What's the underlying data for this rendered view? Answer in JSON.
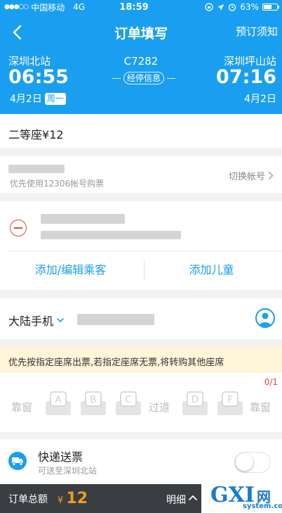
{
  "status_bar": {
    "carrier": "中国移动",
    "network": "4G",
    "time": "18:59",
    "battery": "63%",
    "battery_level": 0.63
  },
  "header": {
    "title": "订单填写",
    "right_action": "预订须知"
  },
  "train": {
    "from_station": "深圳北站",
    "to_station": "深圳坪山站",
    "train_no": "C7282",
    "depart_time": "06:55",
    "arrive_time": "07:16",
    "depart_date": "4月2日",
    "depart_weekday": "周一",
    "arrive_date": "4月2日",
    "stop_info": "经停信息"
  },
  "seat": {
    "label": "二等座",
    "price": "¥12"
  },
  "account": {
    "hint": "优先使用12306帐号购票",
    "switch_label": "切换帐号"
  },
  "passenger": {
    "add_edit_label": "添加/编辑乘客",
    "add_child_label": "添加儿童"
  },
  "contact": {
    "phone_region": "大陆手机"
  },
  "seat_tip": "优先按指定座席出票,若指定座席无票,将转购其他座席",
  "seat_select": {
    "count": "0/1",
    "window_left": "靠窗",
    "aisle": "过道",
    "window_right": "靠窗",
    "seats": [
      "A",
      "B",
      "C",
      "D",
      "F"
    ]
  },
  "express": {
    "title": "快递送票",
    "subtitle": "可送至深圳北站",
    "enabled": false
  },
  "bottom_bar": {
    "total_label": "订单总额",
    "currency": "¥",
    "total": "12",
    "detail_label": "明细"
  },
  "watermark": {
    "logo": "GXI",
    "cn": "网",
    "domain": "system.com"
  }
}
